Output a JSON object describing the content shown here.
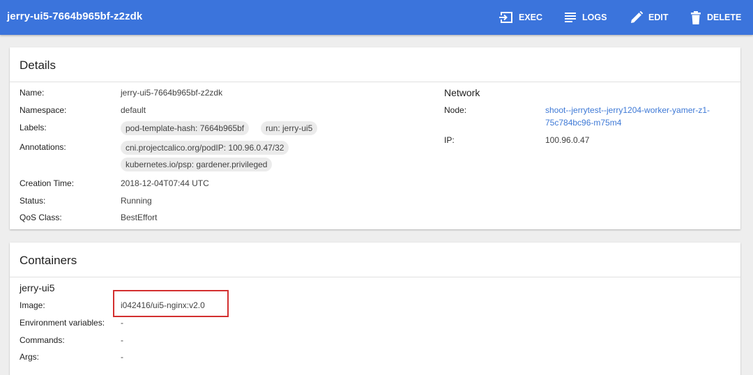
{
  "header": {
    "title": "jerry-ui5-7664b965bf-z2zdk",
    "actions": [
      {
        "label": "EXEC",
        "icon": "exec-icon"
      },
      {
        "label": "LOGS",
        "icon": "logs-icon"
      },
      {
        "label": "EDIT",
        "icon": "edit-icon"
      },
      {
        "label": "DELETE",
        "icon": "delete-icon"
      }
    ]
  },
  "details": {
    "title": "Details",
    "name_label": "Name:",
    "name": "jerry-ui5-7664b965bf-z2zdk",
    "namespace_label": "Namespace:",
    "namespace": "default",
    "labels_label": "Labels:",
    "labels": [
      "pod-template-hash: 7664b965bf",
      "run: jerry-ui5"
    ],
    "annotations_label": "Annotations:",
    "annotations": [
      "cni.projectcalico.org/podIP:  100.96.0.47/32",
      "kubernetes.io/psp:  gardener.privileged"
    ],
    "creation_label": "Creation Time:",
    "creation_time": "2018-12-04T07:44 UTC",
    "status_label": "Status:",
    "status": "Running",
    "qos_label": "QoS Class:",
    "qos_class": "BestEffort",
    "network": {
      "title": "Network",
      "node_label": "Node:",
      "node_line1": "shoot--jerrytest--jerry1204-worker-yamer-z1-",
      "node_line2": "75c784bc96-m75m4",
      "ip_label": "IP:",
      "ip": "100.96.0.47"
    }
  },
  "containers": {
    "title": "Containers",
    "container_name": "jerry-ui5",
    "image_label": "Image:",
    "image": "i042416/ui5-nginx:v2.0",
    "env_label": "Environment variables:",
    "env": "-",
    "commands_label": "Commands:",
    "commands": "-",
    "args_label": "Args:",
    "args": "-"
  },
  "colors": {
    "topbar": "#3b74dc",
    "link": "#3e79d6",
    "highlight": "#d32f2f"
  }
}
